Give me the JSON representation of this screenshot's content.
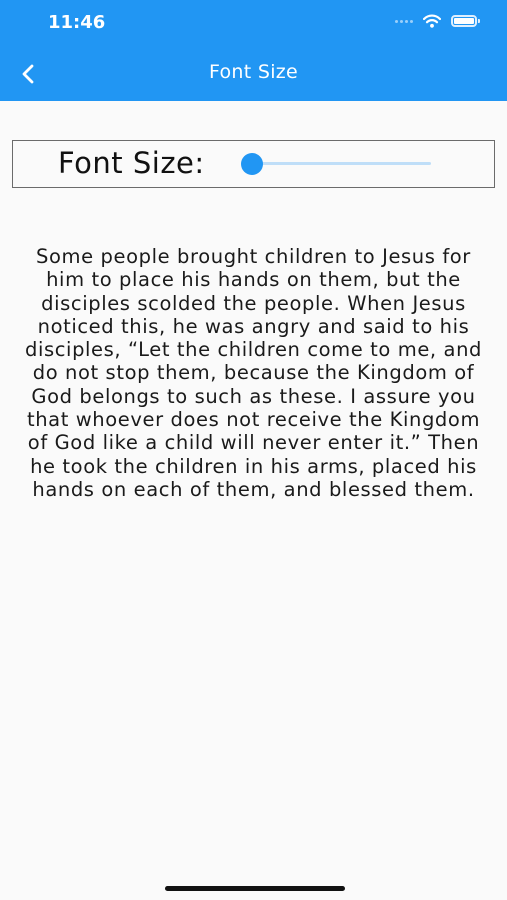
{
  "status_bar": {
    "time": "11:46"
  },
  "app_bar": {
    "title": "Font Size",
    "back_icon": "chevron-left-icon",
    "background_color": "#2196f3"
  },
  "font_control": {
    "label": "Font Size:",
    "slider_value": 0.0,
    "slider_active_color": "#2196f3",
    "slider_inactive_color": "#bfdef8"
  },
  "passage": {
    "text": "Some people brought children to Jesus for him to place his hands on them, but the disciples scolded the people. When Jesus noticed this, he was angry and said to his disciples, “Let the children come to me, and do not stop them, because the Kingdom of God belongs to such as these. I assure you that whoever does not receive the Kingdom of God like a child will never enter it.” Then he took the children in his arms, placed his hands on each of them, and blessed them."
  }
}
